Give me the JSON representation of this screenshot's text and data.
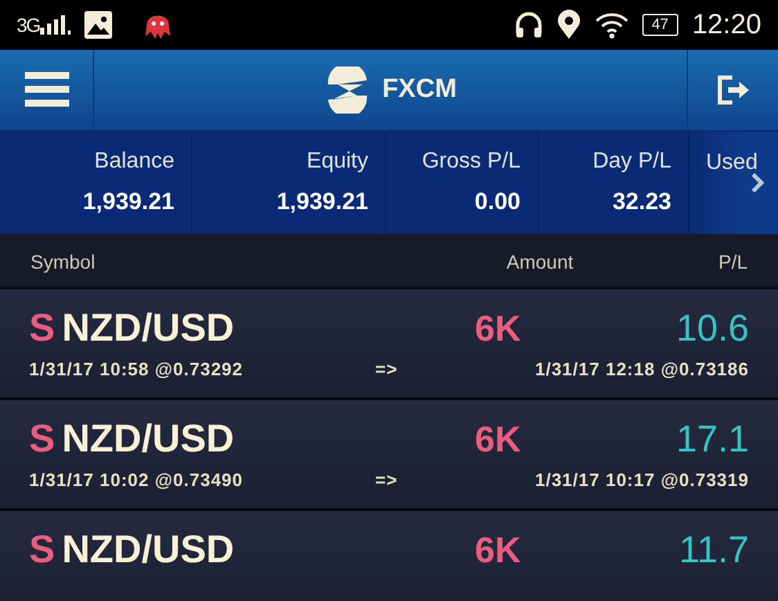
{
  "status_bar": {
    "network": "3G",
    "battery": "47",
    "time": "12:20"
  },
  "header": {
    "title": "FXCM"
  },
  "summary": [
    {
      "label": "Balance",
      "value": "1,939.21"
    },
    {
      "label": "Equity",
      "value": "1,939.21"
    },
    {
      "label": "Gross P/L",
      "value": "0.00"
    },
    {
      "label": "Day P/L",
      "value": "32.23"
    },
    {
      "label": "Used"
    }
  ],
  "columns": [
    "Symbol",
    "Amount",
    "P/L"
  ],
  "rows": [
    {
      "side": "S",
      "symbol": "NZD/USD",
      "amount": "6K",
      "pl": "10.6",
      "open": "1/31/17 10:58 @0.73292",
      "arrow": "=>",
      "close": "1/31/17 12:18 @0.73186"
    },
    {
      "side": "S",
      "symbol": "NZD/USD",
      "amount": "6K",
      "pl": "17.1",
      "open": "1/31/17 10:02 @0.73490",
      "arrow": "=>",
      "close": "1/31/17 10:17 @0.73319"
    },
    {
      "side": "S",
      "symbol": "NZD/USD",
      "amount": "6K",
      "pl": "11.7"
    }
  ]
}
